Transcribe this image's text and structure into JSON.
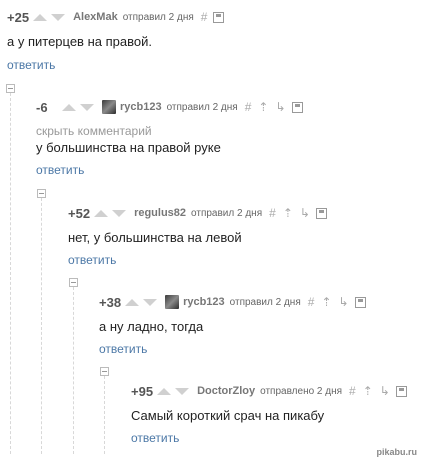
{
  "comments": [
    {
      "rating": "+25",
      "author": "AlexMak",
      "date": "отправил 2 дня",
      "text": "а у питерцев на правой.",
      "reply": "ответить"
    },
    {
      "rating": "-6",
      "author": "rycb123",
      "date": "отправил 2 дня",
      "hide": "скрыть комментарий",
      "text": "у большинства на правой руке",
      "reply": "ответить"
    },
    {
      "rating": "+52",
      "author": "regulus82",
      "date": "отправил 2 дня",
      "text": "нет, у большинства на левой",
      "reply": "ответить"
    },
    {
      "rating": "+38",
      "author": "rycb123",
      "date": "отправил 2 дня",
      "text": "а ну ладно, тогда",
      "reply": "ответить"
    },
    {
      "rating": "+95",
      "author": "DoctorZloy",
      "date": "отправлено 2 дня",
      "text": "Самый короткий срач на пикабу",
      "reply": "ответить"
    }
  ],
  "icons": {
    "hash": "#",
    "up_tree": "⇡",
    "branch": "↳"
  },
  "watermark": "pikabu.ru"
}
